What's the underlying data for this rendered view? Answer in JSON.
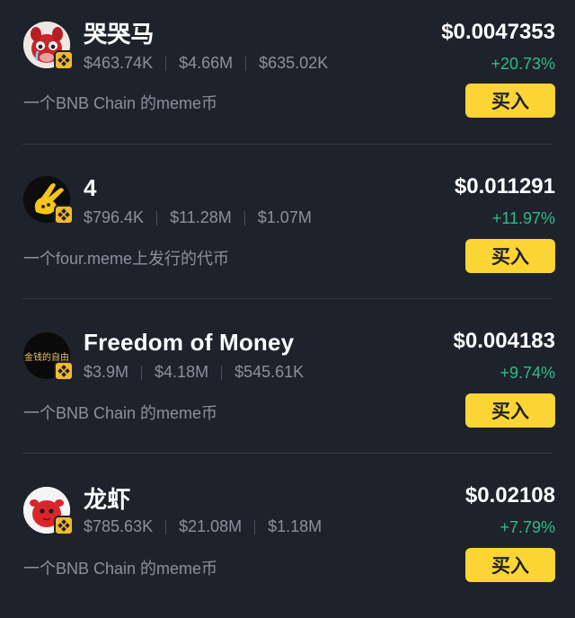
{
  "colors": {
    "background": "#1e222b",
    "buy_button": "#fcd535",
    "positive_change": "#2ebd85",
    "badge": "#f3ba2f"
  },
  "tokens": [
    {
      "name": "哭哭马",
      "avatar_icon": "crying-horse-avatar-icon",
      "stat_1": "$463.74K",
      "stat_2": "$4.66M",
      "stat_3": "$635.02K",
      "description": "一个BNB Chain 的meme币",
      "price": "$0.0047353",
      "change": "+20.73%",
      "buy_label": "买入"
    },
    {
      "name": "4",
      "avatar_icon": "peace-hand-avatar-icon",
      "stat_1": "$796.4K",
      "stat_2": "$11.28M",
      "stat_3": "$1.07M",
      "description": "一个four.meme上发行的代币",
      "price": "$0.011291",
      "change": "+11.97%",
      "buy_label": "买入"
    },
    {
      "name": "Freedom of Money",
      "avatar_icon": "text-logo-avatar-icon",
      "avatar_text": "金钱的自由",
      "stat_1": "$3.9M",
      "stat_2": "$4.18M",
      "stat_3": "$545.61K",
      "description": "一个BNB Chain 的meme币",
      "price": "$0.004183",
      "change": "+9.74%",
      "buy_label": "买入"
    },
    {
      "name": "龙虾",
      "avatar_icon": "red-lobster-avatar-icon",
      "stat_1": "$785.63K",
      "stat_2": "$21.08M",
      "stat_3": "$1.18M",
      "description": "一个BNB Chain 的meme币",
      "price": "$0.02108",
      "change": "+7.79%",
      "buy_label": "买入"
    }
  ]
}
